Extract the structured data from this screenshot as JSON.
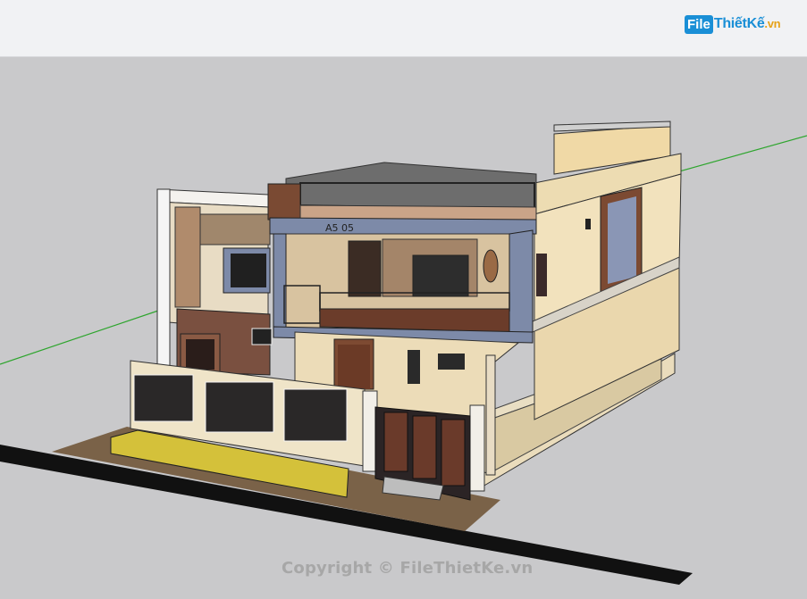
{
  "logo": {
    "brand": "File",
    "name": "ThiếtKế",
    "tld": ".vn"
  },
  "model": {
    "facade_sign": "A5 05"
  },
  "watermark": "Copyright © FileThietKe.vn",
  "colors": {
    "header": "#f1f2f4",
    "viewport": "#c9c9cb",
    "brand_blue": "#1a8fd6",
    "axis_green": "#2ea52e",
    "wall_cream": "#efe2c0",
    "wall_brown": "#8a5a44",
    "accent_blue": "#7d8aa8"
  }
}
